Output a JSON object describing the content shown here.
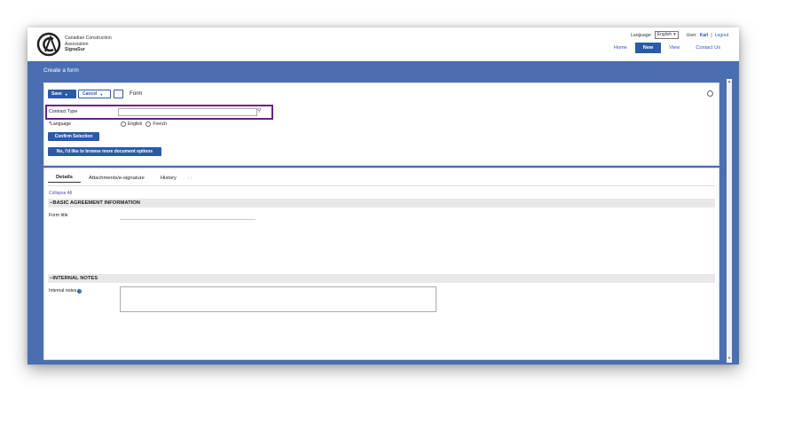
{
  "header": {
    "org_line1": "Canadian Construction",
    "org_line2": "Association",
    "org_line3": "SignaSur",
    "language_label": "Language:",
    "language_value": "English",
    "user_label": "User:",
    "user_name": "Karl",
    "separator": "|",
    "logout": "Logout",
    "nav": [
      "Home",
      "New",
      "View",
      "Contact Us"
    ],
    "nav_active": "New"
  },
  "page": {
    "title": "Create a form"
  },
  "toolbar": {
    "save_label": "Save",
    "cancel_label": "Cancel",
    "more_label": "⋮",
    "form_label": "Form"
  },
  "contract": {
    "label": "Contract Type",
    "value": "",
    "language_label": "Language",
    "options": [
      "English",
      "French"
    ],
    "confirm_label": "Confirm Selection",
    "browse_label": "No, I'd like to browse more document options"
  },
  "tabs": [
    "Details",
    "Attachments/e-signature",
    "History"
  ],
  "tab_arrows": "‹ ›",
  "details": {
    "collapse_all": "Collapse All",
    "section1": "BASIC AGREEMENT INFORMATION",
    "form_title_label": "Form title",
    "section2": "INTERNAL NOTES",
    "internal_notes_label": "Internal notes",
    "help_icon": "?"
  },
  "colors": {
    "accent": "#2b5aa8",
    "highlight": "#6b1f8a",
    "bar": "#4a6fb0"
  }
}
